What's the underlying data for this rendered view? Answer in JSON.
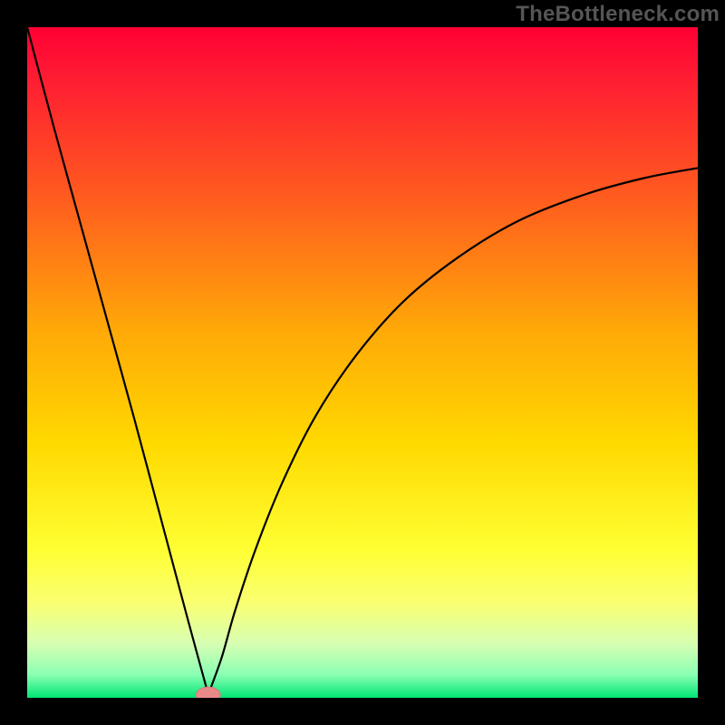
{
  "watermark": "TheBottleneck.com",
  "chart_data": {
    "type": "line",
    "title": "",
    "xlabel": "",
    "ylabel": "",
    "xlim": [
      0,
      100
    ],
    "ylim": [
      0,
      100
    ],
    "gradient": {
      "stops": [
        {
          "offset": 0.0,
          "color": "#ff0033"
        },
        {
          "offset": 0.07,
          "color": "#ff1a33"
        },
        {
          "offset": 0.25,
          "color": "#ff5a1f"
        },
        {
          "offset": 0.45,
          "color": "#ffa808"
        },
        {
          "offset": 0.62,
          "color": "#ffd900"
        },
        {
          "offset": 0.78,
          "color": "#ffff33"
        },
        {
          "offset": 0.86,
          "color": "#f9ff73"
        },
        {
          "offset": 0.92,
          "color": "#d6ffb3"
        },
        {
          "offset": 0.965,
          "color": "#8cffb3"
        },
        {
          "offset": 1.0,
          "color": "#00e676"
        }
      ]
    },
    "curve": {
      "note": "V-shaped bottleneck curve. Left branch: near-linear descent from (0,100) to minimum. Right branch: asymptotic rise toward ~78 at x=100.",
      "x_min": 27,
      "left": [
        {
          "x": 0,
          "y": 100
        },
        {
          "x": 4,
          "y": 85
        },
        {
          "x": 8,
          "y": 70.5
        },
        {
          "x": 12,
          "y": 56
        },
        {
          "x": 16,
          "y": 41.5
        },
        {
          "x": 20,
          "y": 26.5
        },
        {
          "x": 24,
          "y": 11.5
        },
        {
          "x": 27,
          "y": 0.5
        }
      ],
      "right": [
        {
          "x": 27,
          "y": 0.5
        },
        {
          "x": 29,
          "y": 6
        },
        {
          "x": 31,
          "y": 13
        },
        {
          "x": 34,
          "y": 22
        },
        {
          "x": 38,
          "y": 32
        },
        {
          "x": 43,
          "y": 42
        },
        {
          "x": 49,
          "y": 51
        },
        {
          "x": 56,
          "y": 59
        },
        {
          "x": 64,
          "y": 65.5
        },
        {
          "x": 73,
          "y": 71
        },
        {
          "x": 83,
          "y": 75
        },
        {
          "x": 92,
          "y": 77.5
        },
        {
          "x": 100,
          "y": 79
        }
      ]
    },
    "marker": {
      "x": 27,
      "y": 0,
      "rx": 1.8,
      "ry": 1.2,
      "fill": "#e98a8a",
      "stroke": "#d87878"
    }
  }
}
